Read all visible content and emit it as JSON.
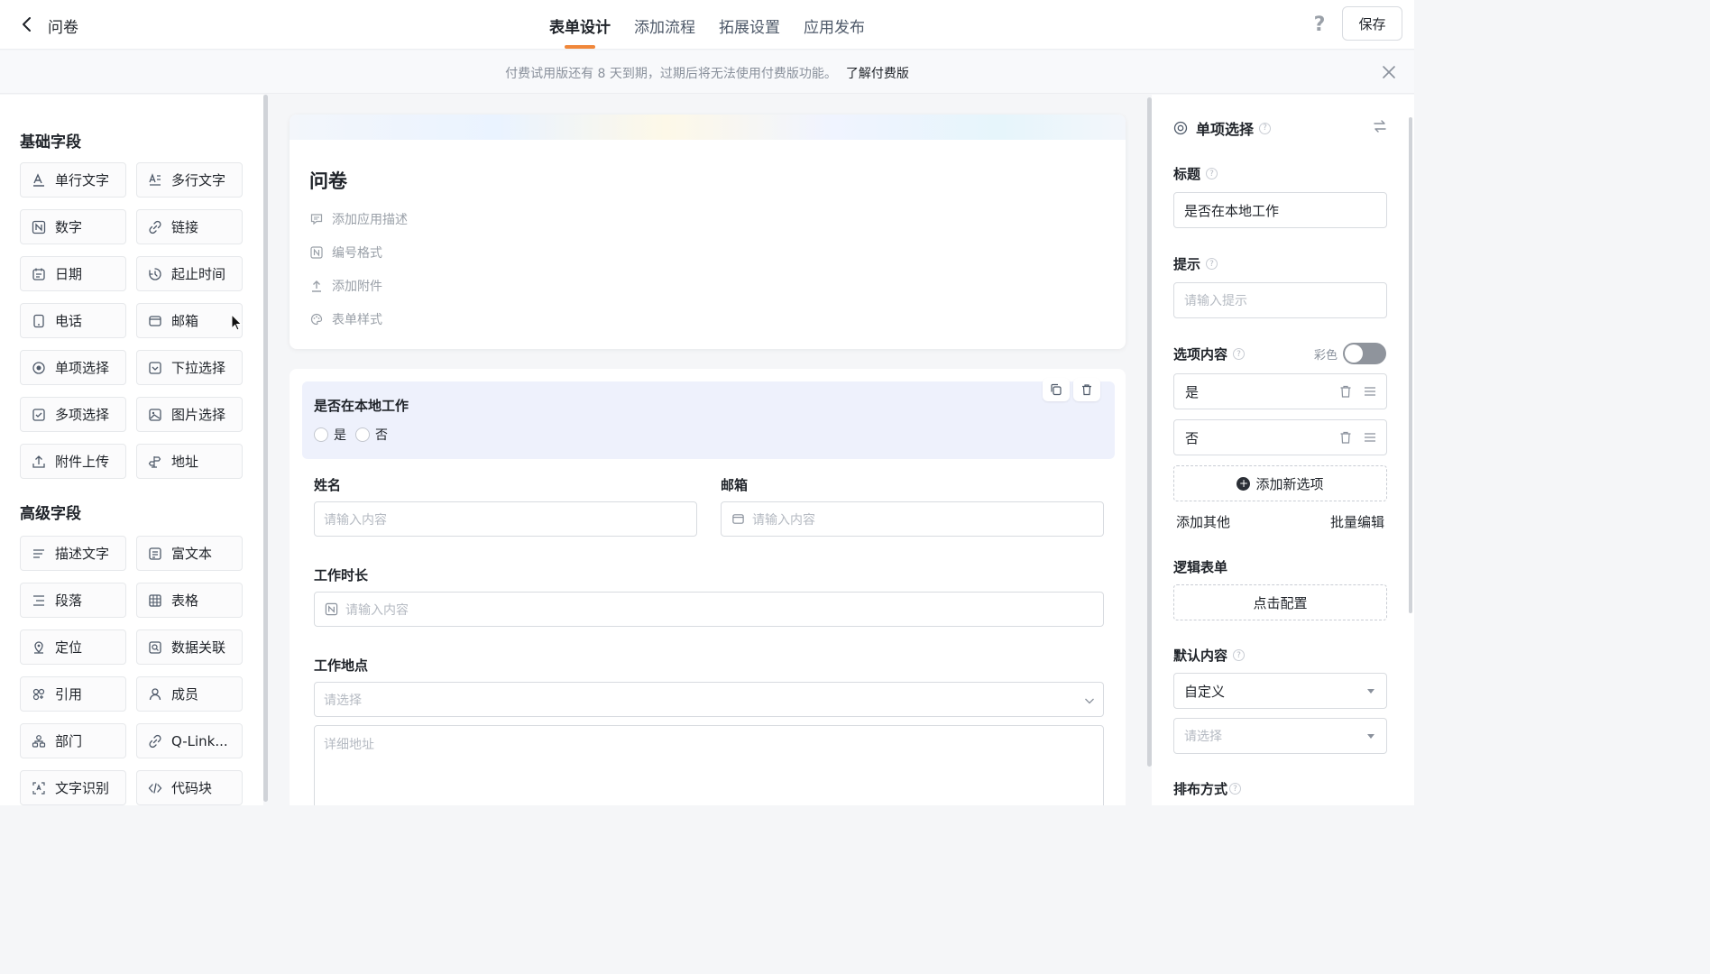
{
  "header": {
    "back_label": "",
    "app_title": "问卷",
    "tabs": [
      {
        "label": "表单设计",
        "active": true
      },
      {
        "label": "添加流程",
        "active": false
      },
      {
        "label": "拓展设置",
        "active": false
      },
      {
        "label": "应用发布",
        "active": false
      }
    ],
    "help_icon": "?",
    "save_label": "保存",
    "accent_color": "#f0873a"
  },
  "banner": {
    "text": "付费试用版还有 8 天到期，过期后将无法使用付费版功能。",
    "link": "了解付费版"
  },
  "left_panel": {
    "basic_title": "基础字段",
    "basic_fields": [
      {
        "label": "单行文字",
        "icon": "single-line-text-icon"
      },
      {
        "label": "多行文字",
        "icon": "multi-line-text-icon"
      },
      {
        "label": "数字",
        "icon": "number-icon"
      },
      {
        "label": "链接",
        "icon": "link-icon"
      },
      {
        "label": "日期",
        "icon": "date-icon"
      },
      {
        "label": "起止时间",
        "icon": "time-range-icon"
      },
      {
        "label": "电话",
        "icon": "phone-icon"
      },
      {
        "label": "邮箱",
        "icon": "email-icon"
      },
      {
        "label": "单项选择",
        "icon": "radio-icon"
      },
      {
        "label": "下拉选择",
        "icon": "dropdown-icon"
      },
      {
        "label": "多项选择",
        "icon": "checkbox-icon"
      },
      {
        "label": "图片选择",
        "icon": "image-icon"
      },
      {
        "label": "附件上传",
        "icon": "upload-icon"
      },
      {
        "label": "地址",
        "icon": "address-icon"
      }
    ],
    "advanced_title": "高级字段",
    "advanced_fields": [
      {
        "label": "描述文字",
        "icon": "description-icon"
      },
      {
        "label": "富文本",
        "icon": "rich-text-icon"
      },
      {
        "label": "段落",
        "icon": "paragraph-icon"
      },
      {
        "label": "表格",
        "icon": "table-icon"
      },
      {
        "label": "定位",
        "icon": "location-icon"
      },
      {
        "label": "数据关联",
        "icon": "data-link-icon"
      },
      {
        "label": "引用",
        "icon": "reference-icon"
      },
      {
        "label": "成员",
        "icon": "member-icon"
      },
      {
        "label": "部门",
        "icon": "department-icon"
      },
      {
        "label": "Q-Link...",
        "icon": "qlink-icon"
      },
      {
        "label": "文字识别",
        "icon": "ocr-icon"
      },
      {
        "label": "代码块",
        "icon": "code-block-icon"
      }
    ]
  },
  "form": {
    "title": "问卷",
    "meta": [
      {
        "label": "添加应用描述",
        "icon": "comment-icon"
      },
      {
        "label": "编号格式",
        "icon": "number-format-icon"
      },
      {
        "label": "添加附件",
        "icon": "attach-upload-icon"
      },
      {
        "label": "表单样式",
        "icon": "palette-icon"
      }
    ],
    "selected_question": {
      "title": "是否在本地工作",
      "options": [
        "是",
        "否"
      ]
    },
    "name_label": "姓名",
    "name_placeholder": "请输入内容",
    "email_label": "邮箱",
    "email_placeholder": "请输入内容",
    "duration_label": "工作时长",
    "duration_placeholder": "请输入内容",
    "location_label": "工作地点",
    "location_select_placeholder": "请选择",
    "address_placeholder": "详细地址"
  },
  "right_panel": {
    "header_title": "单项选择",
    "title_label": "标题",
    "title_value": "是否在本地工作",
    "hint_label": "提示",
    "hint_placeholder": "请输入提示",
    "options_label": "选项内容",
    "color_label": "彩色",
    "color_toggle_on": false,
    "options": [
      "是",
      "否"
    ],
    "add_option": "添加新选项",
    "add_other": "添加其他",
    "batch_edit": "批量编辑",
    "logic_label": "逻辑表单",
    "logic_button": "点击配置",
    "default_label": "默认内容",
    "default_value": "自定义",
    "default_select_placeholder": "请选择",
    "layout_label": "排布方式"
  }
}
